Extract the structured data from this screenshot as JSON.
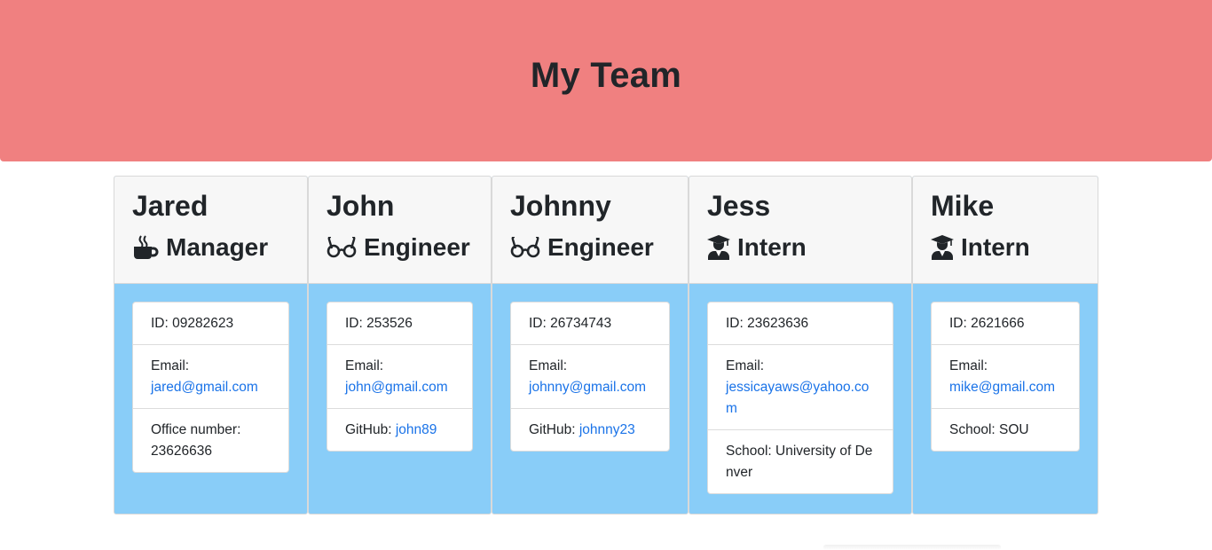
{
  "header": {
    "title": "My Team"
  },
  "labels": {
    "id": "ID: ",
    "email": "Email:",
    "office": "Office number:",
    "github": "GitHub: ",
    "school": "School: "
  },
  "cards": [
    {
      "name": "Jared",
      "role": "Manager",
      "icon": "coffee-mug-icon",
      "id": "09282623",
      "email": "jared@gmail.com",
      "office": "23626636"
    },
    {
      "name": "John",
      "role": "Engineer",
      "icon": "glasses-icon",
      "id": "253526",
      "email": "john@gmail.com",
      "github": "john89"
    },
    {
      "name": "Johnny",
      "role": "Engineer",
      "icon": "glasses-icon",
      "id": "26734743",
      "email": "johnny@gmail.com",
      "github": "johnny23"
    },
    {
      "name": "Jess",
      "role": "Intern",
      "icon": "graduate-icon",
      "id": "23623636",
      "email": "jessicayaws@yahoo.com",
      "school": "University of Denver"
    },
    {
      "name": "Mike",
      "role": "Intern",
      "icon": "graduate-icon",
      "id": "2621666",
      "email": "mike@gmail.com",
      "school": "SOU"
    }
  ],
  "colors": {
    "header_bg": "#f08080",
    "card_body_bg": "#89cdf8",
    "link": "#1a73e8"
  }
}
